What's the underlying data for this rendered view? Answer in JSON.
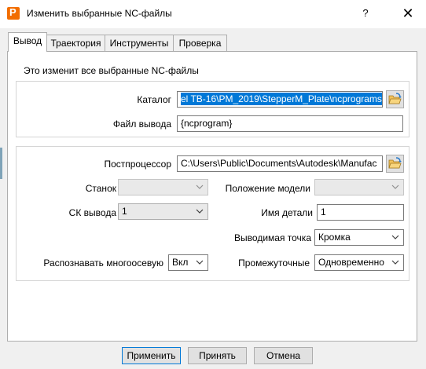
{
  "window": {
    "title": "Изменить выбранные NC-файлы",
    "help": "?",
    "close": "✕"
  },
  "tabs": [
    {
      "label": "Вывод"
    },
    {
      "label": "Траектория"
    },
    {
      "label": "Инструменты"
    },
    {
      "label": "Проверка"
    }
  ],
  "info_text": "Это изменит все выбранные NC-файлы",
  "catalog": {
    "label": "Каталог",
    "value": "el TB-16\\PM_2019\\StepperM_Plate\\ncprograms"
  },
  "output_file": {
    "label": "Файл вывода",
    "value": "{ncprogram}"
  },
  "postprocessor": {
    "label": "Постпроцессор",
    "value": "C:\\Users\\Public\\Documents\\Autodesk\\Manufac"
  },
  "machine": {
    "label": "Станок",
    "value": ""
  },
  "model_position": {
    "label": "Положение модели",
    "value": ""
  },
  "output_cs": {
    "label": "СК вывода",
    "value": "1"
  },
  "part_name": {
    "label": "Имя детали",
    "value": "1"
  },
  "output_point": {
    "label": "Выводимая точка",
    "value": "Кромка"
  },
  "multiaxis": {
    "label": "Распознавать многоосевую",
    "value": "Вкл"
  },
  "intermediate": {
    "label": "Промежуточные",
    "value": "Одновременно"
  },
  "buttons": {
    "apply": "Применить",
    "accept": "Принять",
    "cancel": "Отмена"
  },
  "colors": {
    "accent": "#0078d7",
    "app_icon": "#f26d00"
  },
  "icons": {
    "app": "powermill-icon",
    "browse": "folder-open-icon",
    "dropdown": "chevron-down-icon"
  }
}
